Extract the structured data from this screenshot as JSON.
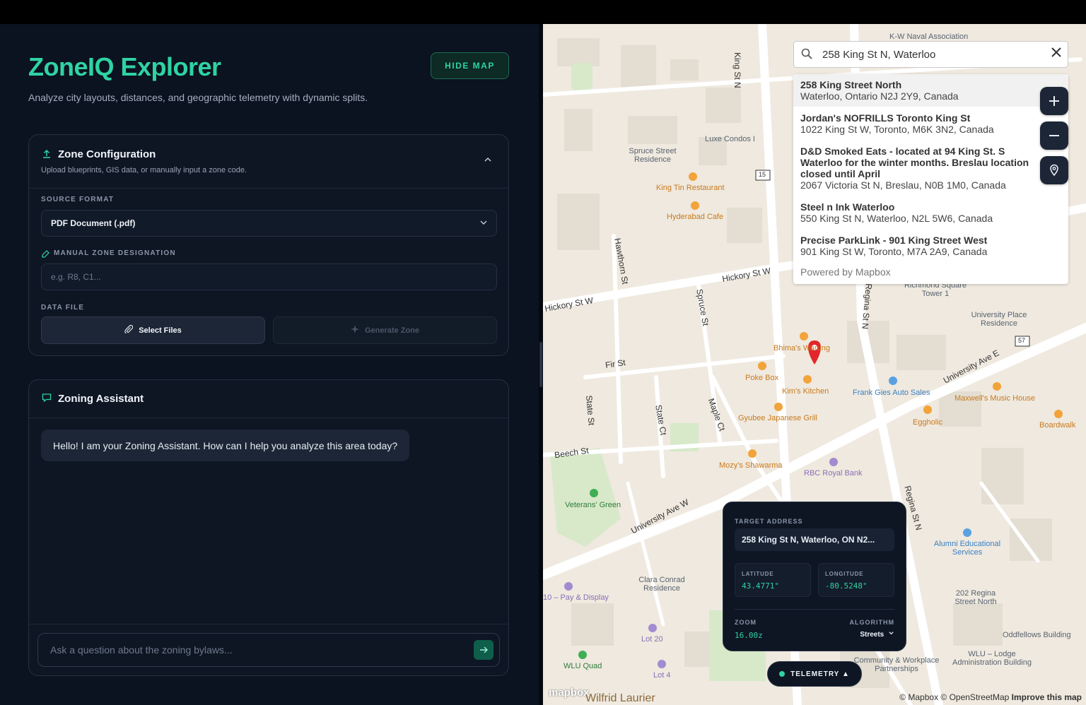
{
  "app": {
    "title": "ZoneIQ Explorer",
    "subtitle": "Analyze city layouts, distances, and geographic telemetry with dynamic splits.",
    "hide_map_label": "HIDE MAP"
  },
  "zone_config": {
    "title": "Zone Configuration",
    "description": "Upload blueprints, GIS data, or manually input a zone code.",
    "source_format_label": "SOURCE FORMAT",
    "source_format_value": "PDF Document (.pdf)",
    "manual_label": "MANUAL ZONE DESIGNATION",
    "manual_placeholder": "e.g. R8, C1...",
    "data_file_label": "DATA FILE",
    "select_files_label": "Select Files",
    "generate_zone_label": "Generate Zone"
  },
  "assistant": {
    "title": "Zoning Assistant",
    "greeting": "Hello! I am your Zoning Assistant. How can I help you analyze this area today?",
    "input_placeholder": "Ask a question about the zoning bylaws..."
  },
  "map": {
    "search_value": "258 King St N, Waterloo",
    "results": [
      {
        "title": "258 King Street North",
        "address": "Waterloo, Ontario N2J 2Y9, Canada"
      },
      {
        "title": "Jordan's NOFRILLS Toronto King St",
        "address": "1022 King St W, Toronto, M6K 3N2, Canada"
      },
      {
        "title": "D&D Smoked Eats - located at 94 King St. S Waterloo for the winter months. Breslau location closed until April",
        "address": "2067 Victoria St N, Breslau, N0B 1M0, Canada"
      },
      {
        "title": "Steel n Ink Waterloo",
        "address": "550 King St N, Waterloo, N2L 5W6, Canada"
      },
      {
        "title": "Precise ParkLink - 901 King Street West",
        "address": "901 King St W, Toronto, M7A 2A9, Canada"
      }
    ],
    "powered_by": "Powered by Mapbox",
    "labels": {
      "kw_naval": "K-W Naval Association",
      "king_st_n": "King St N",
      "spruce_street_res": "Spruce Street Residence",
      "luxe": "Luxe Condos I",
      "king_tin": "King Tin Restaurant",
      "hyderabad": "Hyderabad Cafe",
      "hawthorn": "Hawthorn St",
      "hickory_w1": "Hickory St W",
      "hickory_w2": "Hickory St W",
      "spruce_st": "Spruce St",
      "regina_st_n": "Regina St N",
      "richmond": "Richmond Square Tower 1",
      "univ_place": "University Place Residence",
      "univ_ave_e": "University Ave E",
      "bhimas": "Bhima's Warung",
      "fir_st": "Fir St",
      "poke_box": "Poke Box",
      "kims": "Kim's Kitchen",
      "frank_gies": "Frank Gies Auto Sales",
      "maxwells": "Maxwell's Music House",
      "boardwalk": "Boardwalk",
      "eggholic": "Eggholic",
      "gyubee": "Gyubee Japanese Grill",
      "state_st": "State St",
      "state_ct": "State Ct",
      "maple_ct": "Maple Ct",
      "beech_st": "Beech St",
      "mozys": "Mozy's Shawarma",
      "rbc": "RBC Royal Bank",
      "veterans": "Veterans' Green",
      "univ_ave_w": "University Ave W",
      "regina_st_n2": "Regina St N",
      "alumni": "Alumni Educational Services",
      "pay_display": "10 – Pay & Display",
      "clara": "Clara Conrad Residence",
      "regina_202": "202 Regina Street North",
      "lot20": "Lot 20",
      "oddfellows": "Oddfellows Building",
      "wlu_quad": "WLU Quad",
      "lot4": "Lot 4",
      "community": "Community & Workplace Partnerships",
      "wlu_lodge": "WLU – Lodge Administration Building",
      "wilfrid": "Wilfrid Laurier",
      "route15": "15",
      "route57": "57"
    },
    "attribution": "© Mapbox © OpenStreetMap",
    "improve": "Improve this map",
    "logo": "mapbox"
  },
  "telemetry": {
    "target_label": "TARGET ADDRESS",
    "target_value": "258 King St N, Waterloo, ON N2...",
    "latitude_label": "LATITUDE",
    "latitude_value": "43.4771°",
    "longitude_label": "LONGITUDE",
    "longitude_value": "-80.5248°",
    "zoom_label": "ZOOM",
    "zoom_value": "16.00z",
    "algorithm_label": "ALGORITHM",
    "algorithm_value": "Streets",
    "toggle_label": "TELEMETRY ▲"
  },
  "colors": {
    "accent": "#2fd3a3",
    "panel_bg": "#0b1220",
    "marker": "#e3262b"
  }
}
